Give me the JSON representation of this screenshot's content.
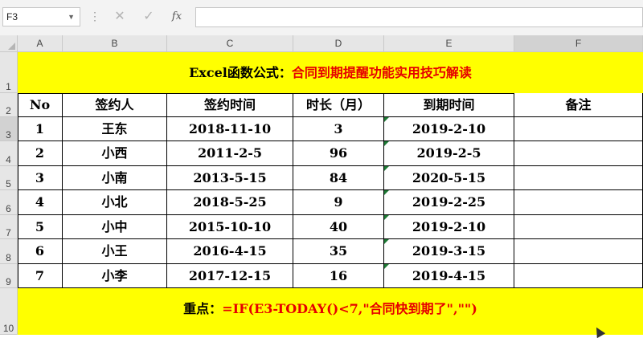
{
  "formula_bar": {
    "name_box": "F3",
    "cancel_icon": "✕",
    "enter_icon": "✓",
    "function_icon": "fx",
    "formula": ""
  },
  "columns": [
    "A",
    "B",
    "C",
    "D",
    "E",
    "F"
  ],
  "rows": [
    "1",
    "2",
    "3",
    "4",
    "5",
    "6",
    "7",
    "8",
    "9",
    "10"
  ],
  "title": {
    "prefix": "Excel函数公式：",
    "highlight": "合同到期提醒功能实用技巧解读"
  },
  "table": {
    "headers": [
      "No",
      "签约人",
      "签约时间",
      "时长（月）",
      "到期时间",
      "备注"
    ],
    "rows": [
      [
        "1",
        "王东",
        "2018-11-10",
        "3",
        "2019-2-10",
        ""
      ],
      [
        "2",
        "小西",
        "2011-2-5",
        "96",
        "2019-2-5",
        ""
      ],
      [
        "3",
        "小南",
        "2013-5-15",
        "84",
        "2020-5-15",
        ""
      ],
      [
        "4",
        "小北",
        "2018-5-25",
        "9",
        "2019-2-25",
        ""
      ],
      [
        "5",
        "小中",
        "2015-10-10",
        "40",
        "2019-2-10",
        ""
      ],
      [
        "6",
        "小王",
        "2016-4-15",
        "35",
        "2019-3-15",
        ""
      ],
      [
        "7",
        "小李",
        "2017-12-15",
        "16",
        "2019-4-15",
        ""
      ]
    ]
  },
  "footer": {
    "label": "重点：",
    "formula": "=IF(E3-TODAY()<7,\"合同快到期了\",\"\")"
  },
  "colors": {
    "banner": "#ffff00",
    "accent_red": "#e60000",
    "error_mark": "#1e7a35"
  }
}
